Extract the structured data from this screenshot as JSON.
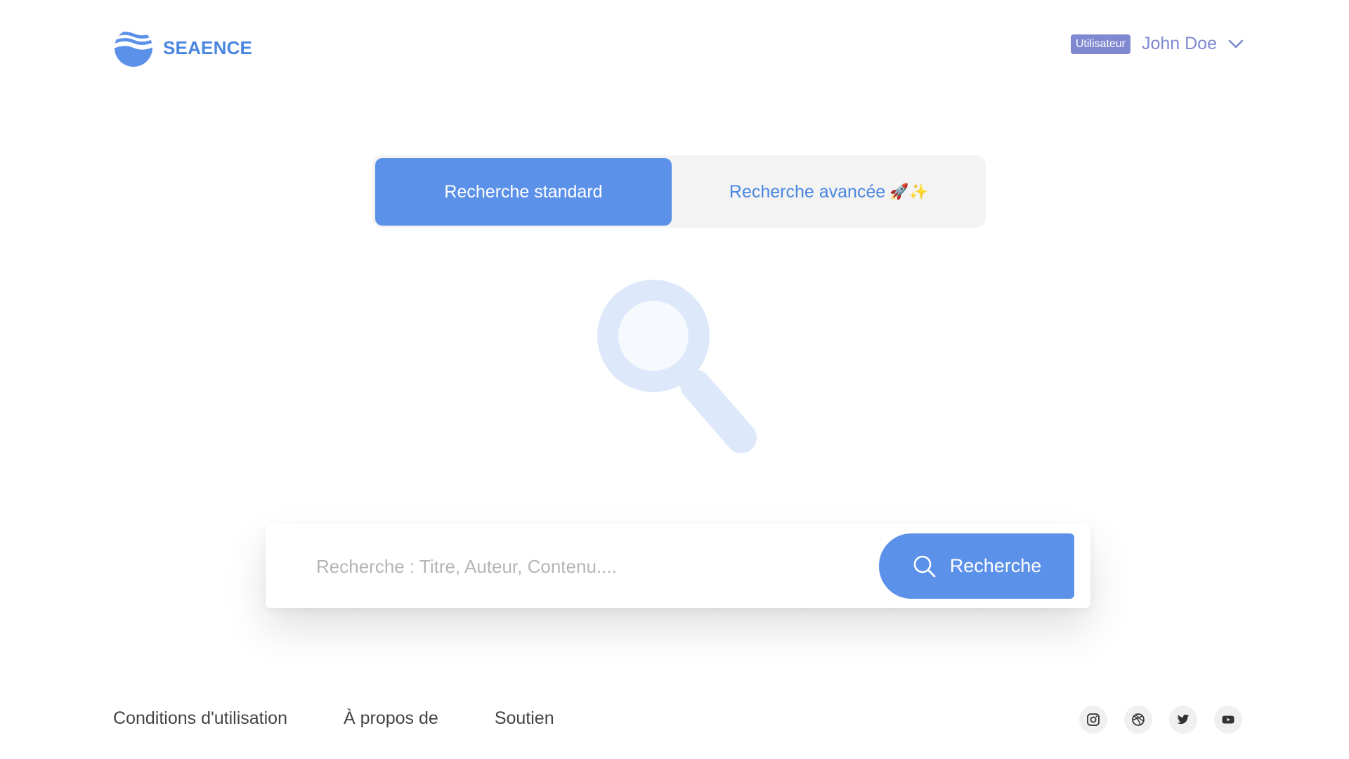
{
  "brand": {
    "name": "SEAENCE",
    "logo_icon": "wave-globe-icon",
    "accent_color": "#5b91e8"
  },
  "user": {
    "role_badge": "Utilisateur",
    "name": "John Doe",
    "menu_icon": "chevron-down-icon"
  },
  "tabs": [
    {
      "label": "Recherche standard",
      "active": true
    },
    {
      "label": "Recherche avancée",
      "emoji": "🚀✨",
      "active": false
    }
  ],
  "search": {
    "placeholder": "Recherche : Titre, Auteur, Contenu....",
    "value": "",
    "button_label": "Recherche",
    "button_icon": "search-icon"
  },
  "footer": {
    "links": [
      "Conditions d'utilisation",
      "À propos de",
      "Soutien"
    ],
    "socials": [
      "instagram-icon",
      "dribbble-icon",
      "twitter-icon",
      "youtube-icon"
    ]
  }
}
